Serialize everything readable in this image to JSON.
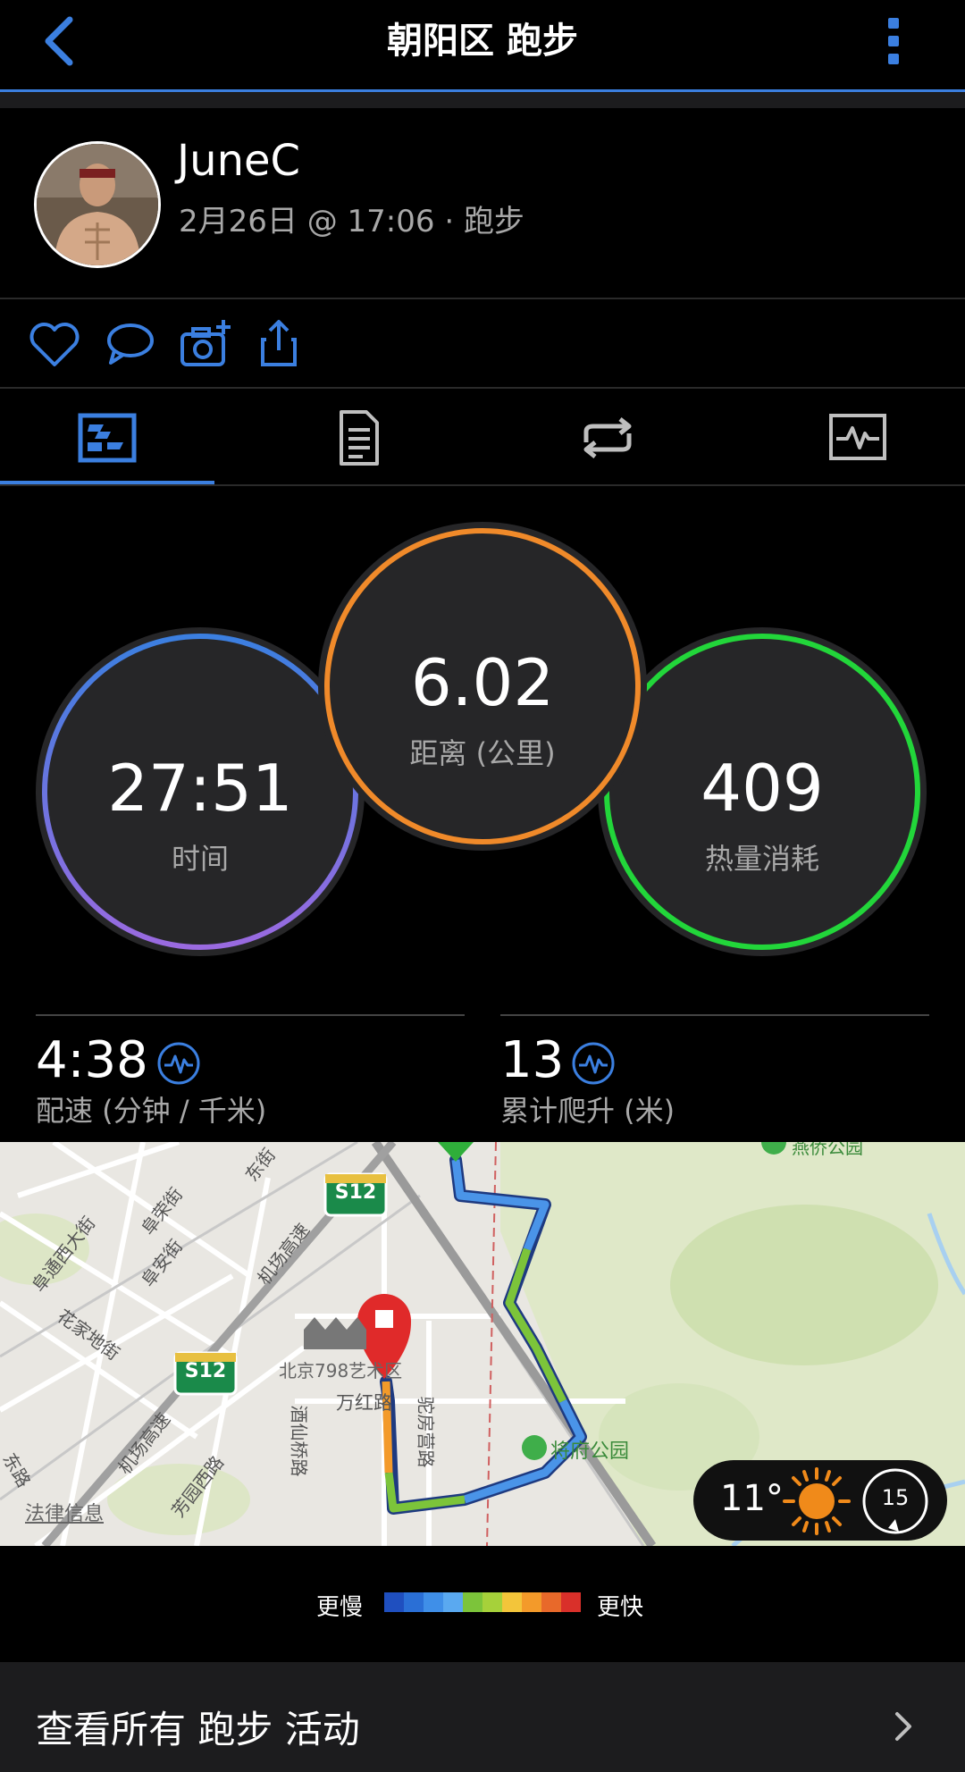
{
  "header": {
    "title": "朝阳区 跑步",
    "back_icon": "chevron-left-icon",
    "more_icon": "more-vertical-icon"
  },
  "user": {
    "name": "JuneC",
    "date": "2月26日 @ 17:06",
    "separator": "·",
    "activity_type": "跑步"
  },
  "actions": [
    {
      "icon": "heart-icon"
    },
    {
      "icon": "comment-icon"
    },
    {
      "icon": "add-photo-icon"
    },
    {
      "icon": "share-icon"
    }
  ],
  "tabs": [
    {
      "icon": "summary-icon",
      "selected": true
    },
    {
      "icon": "details-list-icon",
      "selected": false
    },
    {
      "icon": "laps-icon",
      "selected": false
    },
    {
      "icon": "charts-icon",
      "selected": false
    }
  ],
  "stats": {
    "time": {
      "value": "27:51",
      "label": "时间"
    },
    "distance": {
      "value": "6.02",
      "label": "距离 (公里)"
    },
    "calories": {
      "value": "409",
      "label": "热量消耗"
    },
    "pace": {
      "value": "4:38",
      "label": "配速 (分钟 / 千米)"
    },
    "elevation": {
      "value": "13",
      "label": "累计爬升 (米)"
    }
  },
  "map": {
    "labels": {
      "s12_a": "S12",
      "s12_b": "S12",
      "art_zone": "北京798艺术区",
      "wanhong": "万红路",
      "jiuxianqiao": "酒仙桥路",
      "tuofangying": "驼房营路",
      "jiangfu": "将府公园",
      "fumen": "阜通西大街",
      "fujing": "阜荣街",
      "fujing2": "阜安街",
      "huajia": "花家地街",
      "jichang": "机场高速",
      "jichang2": "机场高速",
      "fangyuan": "芳园西路",
      "legal": "法律信息",
      "east_st": "东街",
      "east_road": "东路",
      "park_top": "燕侨公园"
    },
    "weather": {
      "temperature": "11°",
      "icon": "sun-icon",
      "wind": "15"
    }
  },
  "legend": {
    "slower": "更慢",
    "faster": "更快",
    "colors": [
      "#1f4fbf",
      "#2a6fd6",
      "#3f8fe8",
      "#5aa9f0",
      "#7cc43a",
      "#a6d13a",
      "#f3c53a",
      "#f39a2a",
      "#e8692a",
      "#d9302a"
    ]
  },
  "footer": {
    "label": "查看所有 跑步 活动",
    "chevron": "chevron-right-icon"
  },
  "colors": {
    "accent": "#3b7fe0",
    "distance_ring": "#f08a2a",
    "calories_ring": "#22d63a"
  }
}
